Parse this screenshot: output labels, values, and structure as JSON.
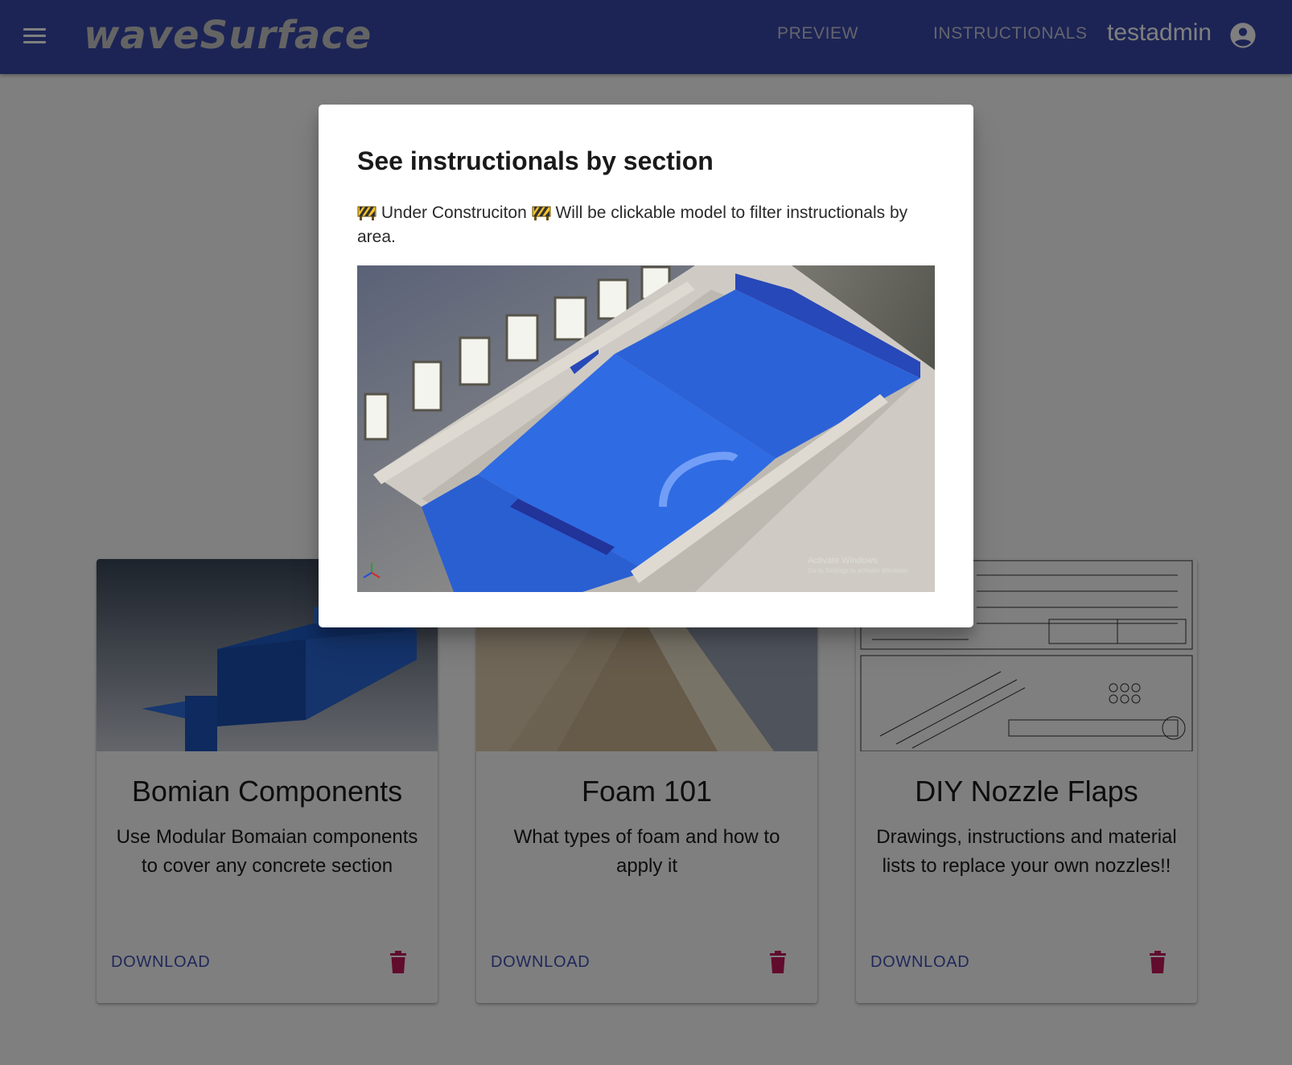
{
  "appbar": {
    "logo_text": "waveSurface",
    "nav": {
      "preview": "PREVIEW",
      "instructionals": "INSTRUCTIONALS"
    },
    "username": "testadmin",
    "icons": {
      "menu": "menu-icon",
      "account": "account-circle-icon"
    },
    "color": "#3949ab"
  },
  "cards": [
    {
      "title": "Bomian Components",
      "description": "Use Modular Bomaian components to cover any concrete section",
      "download_label": "DOWNLOAD"
    },
    {
      "title": "Foam 101",
      "description": "What types of foam and how to apply it",
      "download_label": "DOWNLOAD"
    },
    {
      "title": "DIY Nozzle Flaps",
      "description": "Drawings, instructions and material lists to replace your own nozzles!!",
      "download_label": "DOWNLOAD"
    }
  ],
  "dialog": {
    "title": "See instructionals by section",
    "text_part1": "Under Construciton",
    "text_part2": "Will be clickable model to filter instructionals by area.",
    "icons": {
      "construction": "construction-icon"
    },
    "image_watermark": "Activate Windows",
    "image_watermark_sub": "Go to Settings to activate Windows."
  },
  "colors": {
    "accent": "#3f51b5",
    "delete": "#c2185b",
    "backdrop": "rgba(0,0,0,0.5)"
  }
}
